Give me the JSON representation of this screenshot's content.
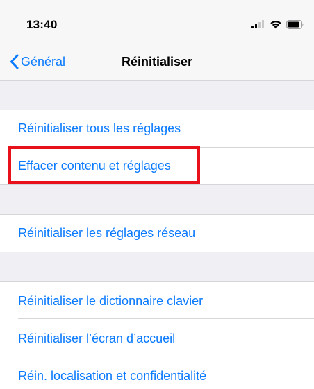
{
  "status_bar": {
    "time": "13:40"
  },
  "nav": {
    "back_label": "Général",
    "title": "Réinitialiser"
  },
  "items": [
    {
      "label": "Réinitialiser tous les réglages"
    },
    {
      "label": "Effacer contenu et réglages"
    },
    {
      "label": "Réinitialiser les réglages réseau"
    },
    {
      "label": "Réinitialiser le dictionnaire clavier"
    },
    {
      "label": "Réinitialiser l’écran d’accueil"
    },
    {
      "label": "Réin. localisation et confidentialité"
    }
  ],
  "colors": {
    "accent": "#0a7aff",
    "highlight": "#e8111b",
    "group_background": "#efeff4"
  }
}
